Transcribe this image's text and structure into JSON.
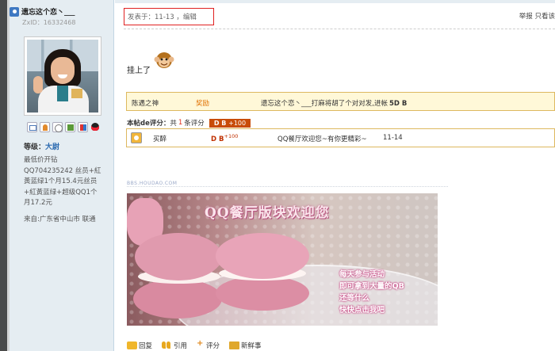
{
  "user": {
    "name": "遗忘这个恋丶___",
    "zxid": "ZxID：16332468",
    "level_label": "等级：",
    "level_value": "大尉",
    "desc": "最低价开钻QQ704235242 丝员+紅黃蓝绿1个月15.4元丝员+紅黃蓝绿+超级QQ1个月17.2元",
    "from": "来自:广东省中山市 联通"
  },
  "post": {
    "meta": "发表于：11-13 ，编辑",
    "report_links": "举报 只看该",
    "text": "挂上了"
  },
  "reward": {
    "giver": "陈遇之神",
    "label": "奖励",
    "text": "遗忘这个恋丶___打麻将胡了个对对发,进帐",
    "amount": "5D B"
  },
  "rating": {
    "label": "本帖de评分：",
    "prefix": "共",
    "count": "1",
    "suffix": "条评分",
    "badge": "D B",
    "badge_sup": "+100",
    "rows": [
      {
        "user": "买醉",
        "score": "D B",
        "score_sup": "+100",
        "reason": "QQ餐厅欢迎您~有你更精彩~",
        "date": "11-14"
      }
    ]
  },
  "image": {
    "caption": "BBS.HOUDAO.COM",
    "title": "QQ餐厅版块欢迎您",
    "lines": [
      "每天参与活动",
      "即可拿到大量的QB",
      "还等什么",
      "快快点击我吧"
    ]
  },
  "actions": {
    "reply": "回复",
    "quote": "引用",
    "rate": "评分",
    "news": "新鲜事"
  },
  "colors": {
    "sidebar_bg": "#e5edf2",
    "reward_bg": "#fff8d8",
    "accent_orange": "#c84c09",
    "highlight_red": "#e02020"
  }
}
